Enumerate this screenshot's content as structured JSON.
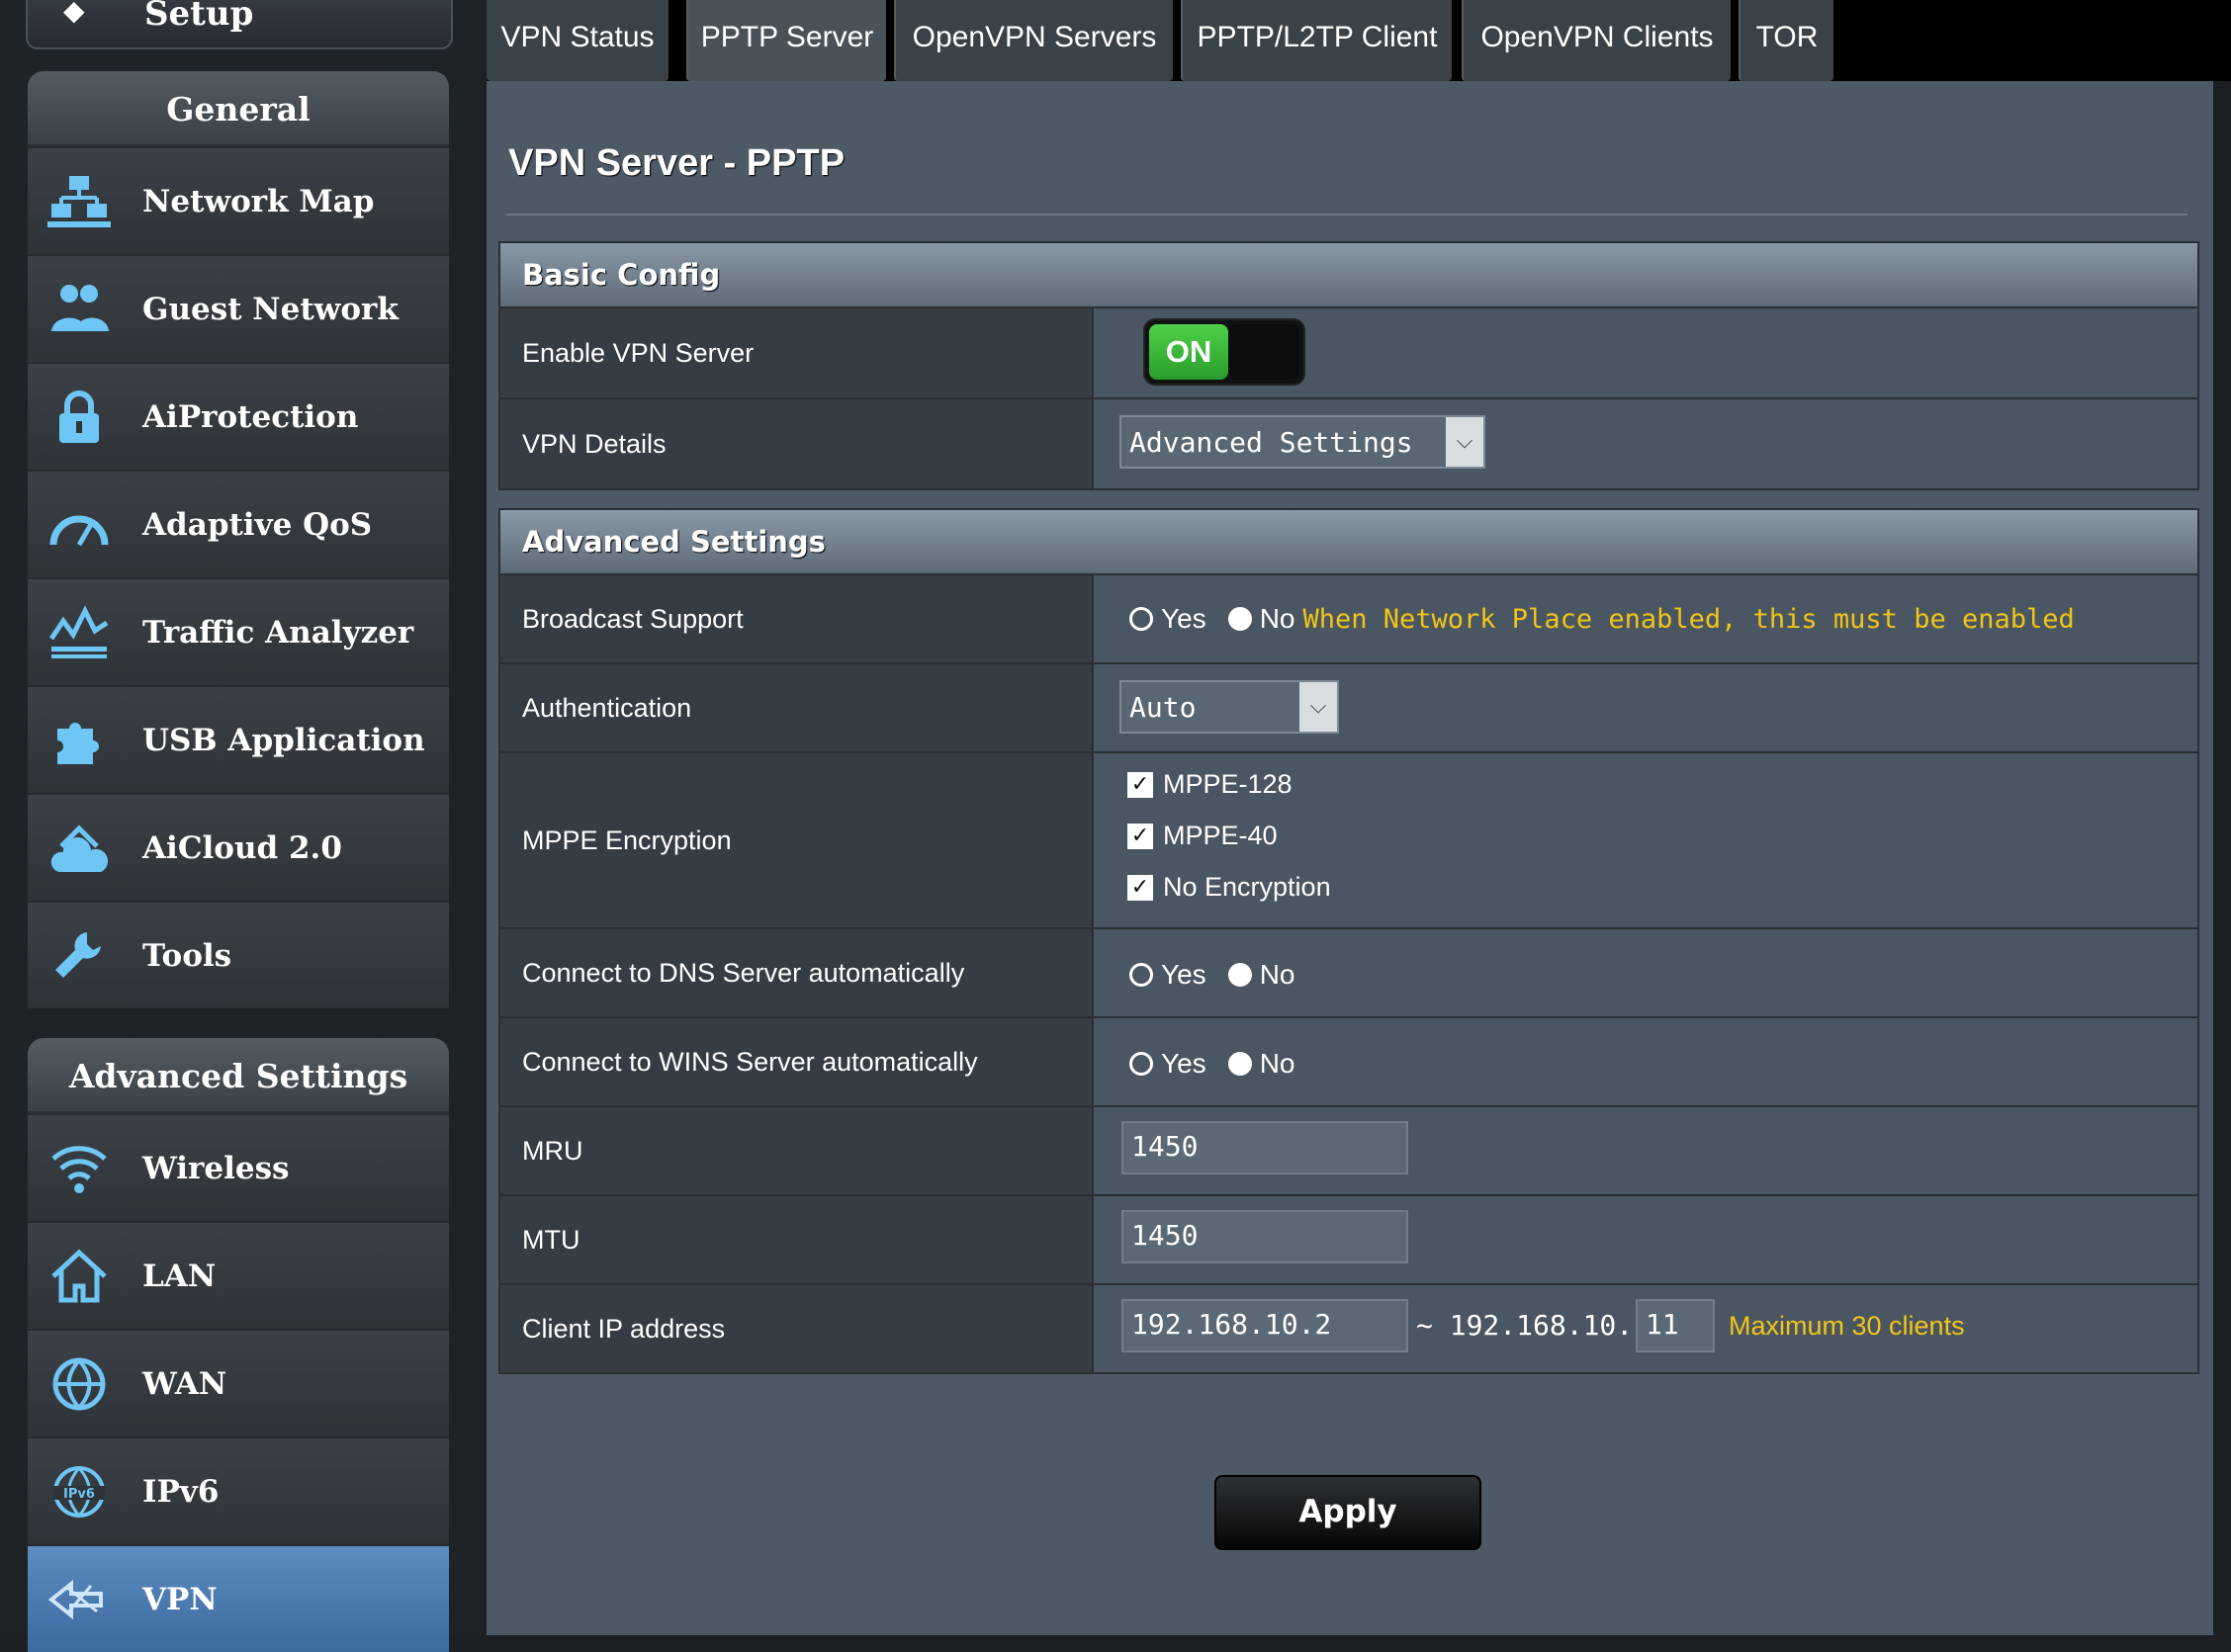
{
  "sidebar": {
    "setup_label": "Setup",
    "general_header": "General",
    "general_items": [
      {
        "label": "Network Map",
        "icon": "network-map-icon"
      },
      {
        "label": "Guest Network",
        "icon": "guest-network-icon"
      },
      {
        "label": "AiProtection",
        "icon": "lock-icon"
      },
      {
        "label": "Adaptive QoS",
        "icon": "gauge-icon"
      },
      {
        "label": "Traffic Analyzer",
        "icon": "traffic-chart-icon"
      },
      {
        "label": "USB Application",
        "icon": "puzzle-icon"
      },
      {
        "label": "AiCloud 2.0",
        "icon": "cloud-house-icon"
      },
      {
        "label": "Tools",
        "icon": "wrench-icon"
      }
    ],
    "advanced_header": "Advanced Settings",
    "advanced_items": [
      {
        "label": "Wireless",
        "icon": "wifi-icon"
      },
      {
        "label": "LAN",
        "icon": "home-icon"
      },
      {
        "label": "WAN",
        "icon": "globe-icon"
      },
      {
        "label": "IPv6",
        "icon": "ipv6-globe-icon"
      },
      {
        "label": "VPN",
        "icon": "vpn-icon",
        "active": true
      }
    ]
  },
  "tabs": [
    "VPN Status",
    "PPTP Server",
    "OpenVPN Servers",
    "PPTP/L2TP Client",
    "OpenVPN Clients",
    "TOR"
  ],
  "active_tab": "PPTP Server",
  "page_title": "VPN Server - PPTP",
  "basic_config": {
    "header": "Basic Config",
    "enable_label": "Enable VPN Server",
    "toggle_on": "ON",
    "details_label": "VPN Details",
    "details_value": "Advanced Settings"
  },
  "advanced": {
    "header": "Advanced Settings",
    "broadcast_label": "Broadcast Support",
    "broadcast_yes": "Yes",
    "broadcast_no": "No",
    "broadcast_selected": "No",
    "broadcast_note": "When Network Place enabled, this must be enabled",
    "auth_label": "Authentication",
    "auth_value": "Auto",
    "mppe_label": "MPPE Encryption",
    "mppe_options": [
      "MPPE-128",
      "MPPE-40",
      "No Encryption"
    ],
    "dns_label": "Connect to DNS Server automatically",
    "dns_yes": "Yes",
    "dns_no": "No",
    "dns_selected": "No",
    "wins_label": "Connect to WINS Server automatically",
    "wins_yes": "Yes",
    "wins_no": "No",
    "wins_selected": "No",
    "mru_label": "MRU",
    "mru_value": "1450",
    "mtu_label": "MTU",
    "mtu_value": "1450",
    "client_ip_label": "Client IP address",
    "client_ip_start": "192.168.10.2",
    "client_ip_end_prefix": "~ 192.168.10.",
    "client_ip_end": "11",
    "client_ip_note": "Maximum 30 clients"
  },
  "apply_label": "Apply",
  "colors": {
    "accent_warn": "#f2c517",
    "toggle_on": "#3bb83a",
    "active_menu": "#4a7ab0"
  }
}
